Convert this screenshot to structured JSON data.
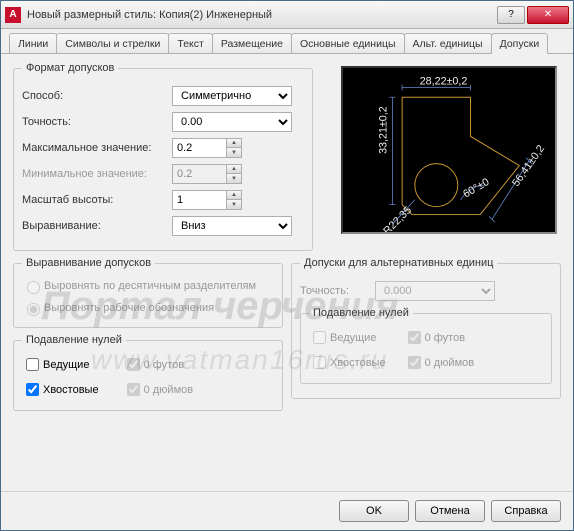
{
  "window": {
    "title": "Новый размерный стиль: Копия(2) Инженерный"
  },
  "tabs": [
    "Линии",
    "Символы и стрелки",
    "Текст",
    "Размещение",
    "Основные единицы",
    "Альт. единицы",
    "Допуски"
  ],
  "active_tab": 6,
  "fmt": {
    "legend": "Формат допусков",
    "method_label": "Способ:",
    "method_value": "Симметрично",
    "precision_label": "Точность:",
    "precision_value": "0.00",
    "max_label": "Максимальное значение:",
    "max_value": "0.2",
    "min_label": "Минимальное значение:",
    "min_value": "0.2",
    "scale_label": "Масштаб высоты:",
    "scale_value": "1",
    "align_label": "Выравнивание:",
    "align_value": "Вниз"
  },
  "tol_align": {
    "legend": "Выравнивание допусков",
    "opt1": "Выровнять по десятичным разделителям",
    "opt2": "Выровнять рабочие обозначения"
  },
  "zero_sup": {
    "legend": "Подавление нулей",
    "leading": "Ведущие",
    "trailing": "Хвостовые",
    "feet": "0 футов",
    "inches": "0 дюймов"
  },
  "alt": {
    "legend": "Допуски для альтернативных единиц",
    "precision_label": "Точность:",
    "precision_value": "0.000",
    "zero_legend": "Подавление нулей",
    "leading": "Ведущие",
    "trailing": "Хвостовые",
    "feet": "0 футов",
    "inches": "0 дюймов"
  },
  "buttons": {
    "ok": "OK",
    "cancel": "Отмена",
    "help": "Справка"
  },
  "preview": {
    "dim_top": "28,22±0,2",
    "dim_left": "33,21±0,2",
    "dim_right": "56,41±0,2",
    "dim_angle": "60°±0",
    "dim_rad": "R22,35"
  },
  "watermark": {
    "l1": "Портал черчения",
    "l2": "www.vatman16rus.ru"
  }
}
